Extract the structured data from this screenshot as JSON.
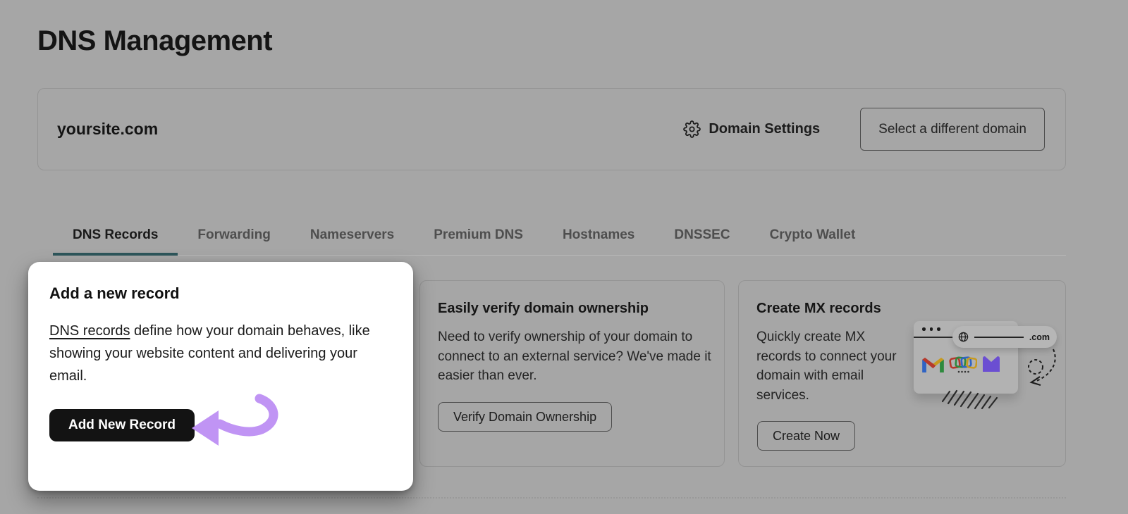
{
  "page": {
    "title": "DNS Management",
    "background_color": "#a6a6a6",
    "note": "page content dimmed by tutorial overlay except spotlight card"
  },
  "domain_bar": {
    "domain": "yoursite.com",
    "settings_label": "Domain Settings",
    "settings_icon": "gear-icon",
    "select_domain_button": "Select a different domain"
  },
  "tabs": {
    "items": [
      {
        "label": "DNS Records",
        "active": true
      },
      {
        "label": "Forwarding",
        "active": false
      },
      {
        "label": "Nameservers",
        "active": false
      },
      {
        "label": "Premium DNS",
        "active": false
      },
      {
        "label": "Hostnames",
        "active": false
      },
      {
        "label": "DNSSEC",
        "active": false
      },
      {
        "label": "Crypto Wallet",
        "active": false
      }
    ]
  },
  "cards": {
    "add_record": {
      "title": "Add a new record",
      "link_text": "DNS records",
      "body_rest": " define how your domain behaves, like\nshowing your website content and delivering your\nemail.",
      "button": "Add New Record"
    },
    "verify": {
      "title": "Easily verify domain ownership",
      "body": "Need to verify ownership of your domain to\nconnect to an external service? We've made it\neasier than ever.",
      "button": "Verify Domain Ownership"
    },
    "mx": {
      "title": "Create MX records",
      "body": "Quickly create MX\nrecords to connect your\ndomain with email\nservices.",
      "button": "Create Now",
      "illustration": {
        "tld_label": ".com",
        "icons": [
          "browser-window-icon",
          "globe-icon",
          "gmail-icon",
          "email-squares-icon",
          "purple-mail-icon",
          "dashed-arrow-doodle",
          "hatch-marks"
        ]
      }
    }
  },
  "colors": {
    "accent_teal_underline": "#2d565b",
    "arrow_purple": "#c094f4",
    "spotlight_bg": "#ffffff",
    "primary_button_bg": "#131313",
    "dim_background": "#a6a6a6",
    "gmail_red": "#b6392c",
    "gmail_blue": "#2f63c4",
    "gmail_green": "#2e8a3e",
    "gmail_yellow": "#c79a20",
    "mail_purple": "#6b4ed2"
  }
}
